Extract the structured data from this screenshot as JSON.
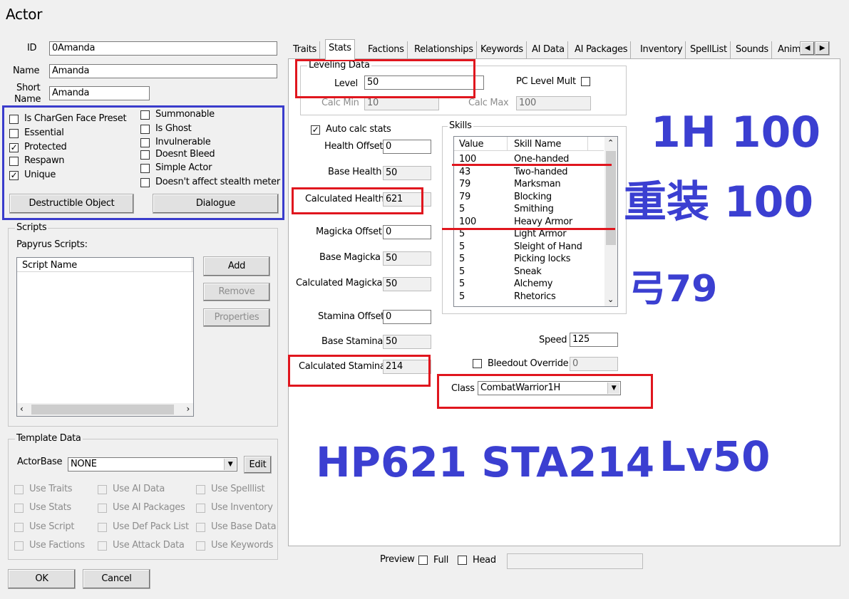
{
  "window": {
    "title": "Actor"
  },
  "identity": {
    "id_label": "ID",
    "id_value": "0Amanda",
    "name_label": "Name",
    "name_value": "Amanda",
    "short_name_label_1": "Short",
    "short_name_label_2": "Name",
    "short_name_value": "Amanda"
  },
  "flags": {
    "left": [
      {
        "label": "Is CharGen Face Preset",
        "checked": false
      },
      {
        "label": "Essential",
        "checked": false
      },
      {
        "label": "Protected",
        "checked": true
      },
      {
        "label": "Respawn",
        "checked": false
      },
      {
        "label": "Unique",
        "checked": true
      }
    ],
    "right": [
      {
        "label": "Summonable",
        "checked": false
      },
      {
        "label": "Is Ghost",
        "checked": false
      },
      {
        "label": "Invulnerable",
        "checked": false
      },
      {
        "label": "Doesnt Bleed",
        "checked": false
      },
      {
        "label": "Simple Actor",
        "checked": false
      },
      {
        "label": "Doesn't affect stealth meter",
        "checked": false
      }
    ],
    "destructible_label": "Destructible Object",
    "dialogue_label": "Dialogue"
  },
  "scripts": {
    "group_title": "Scripts",
    "papyrus_label": "Papyrus Scripts:",
    "column_header": "Script Name",
    "add_label": "Add",
    "remove_label": "Remove",
    "properties_label": "Properties"
  },
  "template": {
    "group_title": "Template Data",
    "actorbase_label": "ActorBase",
    "actorbase_value": "NONE",
    "edit_label": "Edit",
    "options": [
      [
        "Use Traits",
        "Use AI Data",
        "Use Spelllist"
      ],
      [
        "Use Stats",
        "Use AI Packages",
        "Use Inventory"
      ],
      [
        "Use Script",
        "Use Def Pack List",
        "Use Base Data"
      ],
      [
        "Use Factions",
        "Use Attack Data",
        "Use Keywords"
      ]
    ]
  },
  "footer": {
    "ok_label": "OK",
    "cancel_label": "Cancel",
    "preview_label": "Preview",
    "full_label": "Full",
    "head_label": "Head"
  },
  "tabs": [
    "Traits",
    "Stats",
    "Factions",
    "Relationships",
    "Keywords",
    "AI Data",
    "AI Packages",
    "Inventory",
    "SpellList",
    "Sounds",
    "Anim"
  ],
  "active_tab": "Stats",
  "leveling": {
    "group_title": "Leveling Data",
    "level_label": "Level",
    "level_value": "50",
    "pc_level_mult_label": "PC Level Mult",
    "calc_min_label": "Calc Min",
    "calc_min_value": "10",
    "calc_max_label": "Calc Max",
    "calc_max_value": "100"
  },
  "stats": {
    "auto_calc_label": "Auto calc stats",
    "health_offset_label": "Health Offset",
    "health_offset_value": "0",
    "base_health_label": "Base Health",
    "base_health_value": "50",
    "calc_health_label": "Calculated Health",
    "calc_health_value": "621",
    "magicka_offset_label": "Magicka Offset",
    "magicka_offset_value": "0",
    "base_magicka_label": "Base Magicka",
    "base_magicka_value": "50",
    "calc_magicka_label": "Calculated Magicka",
    "calc_magicka_value": "50",
    "stamina_offset_label": "Stamina Offset",
    "stamina_offset_value": "0",
    "base_stamina_label": "Base Stamina",
    "base_stamina_value": "50",
    "calc_stamina_label": "Calculated Stamina",
    "calc_stamina_value": "214",
    "speed_label": "Speed",
    "speed_value": "125",
    "bleedout_label": "Bleedout Override",
    "bleedout_value": "0",
    "class_label": "Class",
    "class_value": "CombatWarrior1H"
  },
  "skills": {
    "group_title": "Skills",
    "col_value": "Value",
    "col_name": "Skill Name",
    "rows": [
      {
        "value": "100",
        "name": "One-handed"
      },
      {
        "value": "43",
        "name": "Two-handed"
      },
      {
        "value": "79",
        "name": "Marksman"
      },
      {
        "value": "79",
        "name": "Blocking"
      },
      {
        "value": "5",
        "name": "Smithing"
      },
      {
        "value": "100",
        "name": "Heavy Armor"
      },
      {
        "value": "5",
        "name": "Light Armor"
      },
      {
        "value": "5",
        "name": "Sleight of Hand"
      },
      {
        "value": "5",
        "name": "Picking locks"
      },
      {
        "value": "5",
        "name": "Sneak"
      },
      {
        "value": "5",
        "name": "Alchemy"
      },
      {
        "value": "5",
        "name": "Rhetorics"
      }
    ]
  },
  "annotations": {
    "one_hand": "1H 100",
    "heavy_armor": "重装 100",
    "bow": "弓79",
    "summary": "HP621 STA214",
    "level": "Lv50"
  },
  "colors": {
    "annotation_blue": "#3b3fd1",
    "highlight_red": "#e0161e",
    "window_bg": "#f0f0f0"
  }
}
